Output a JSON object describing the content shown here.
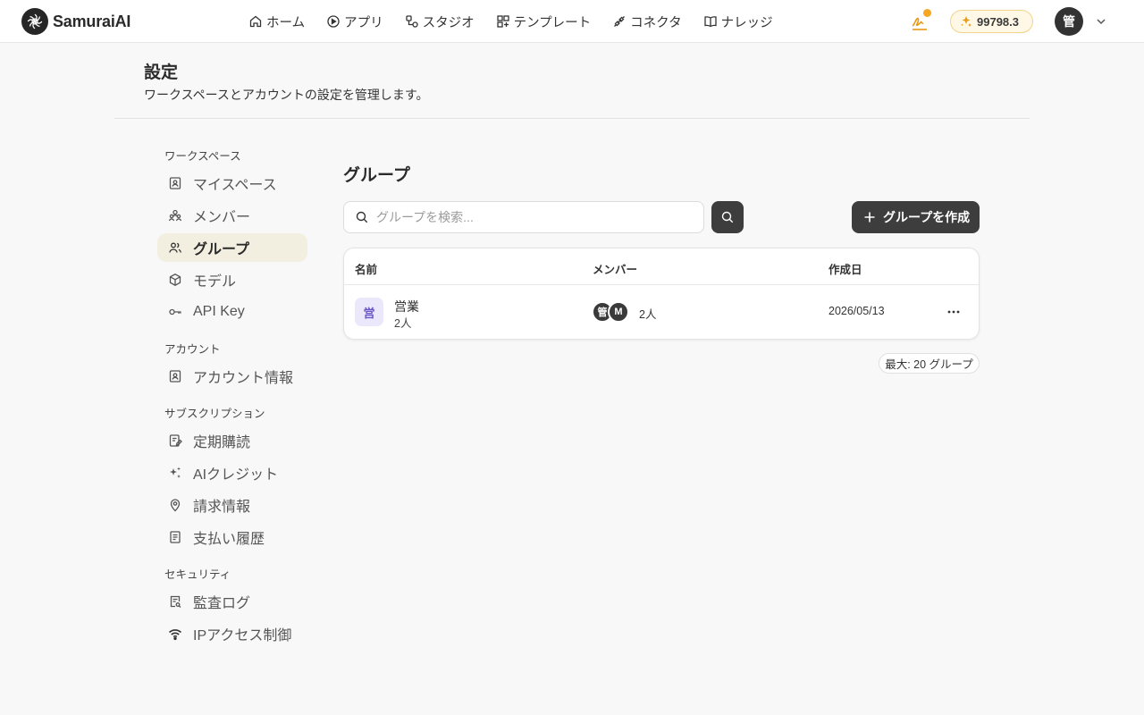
{
  "brand": {
    "name": "SamuraiAI"
  },
  "nav": {
    "items": [
      {
        "label": "ホーム",
        "icon": "home-icon"
      },
      {
        "label": "アプリ",
        "icon": "app-icon"
      },
      {
        "label": "スタジオ",
        "icon": "studio-icon"
      },
      {
        "label": "テンプレート",
        "icon": "template-icon"
      },
      {
        "label": "コネクタ",
        "icon": "connector-icon"
      },
      {
        "label": "ナレッジ",
        "icon": "book-icon"
      }
    ]
  },
  "header_right": {
    "credits": "99798.3",
    "avatar_initial": "管"
  },
  "page": {
    "title": "設定",
    "subtitle": "ワークスペースとアカウントの設定を管理します。"
  },
  "sidebar": {
    "sections": [
      {
        "label": "ワークスペース"
      },
      {
        "label": "アカウント"
      },
      {
        "label": "サブスクリプション"
      },
      {
        "label": "セキュリティ"
      }
    ],
    "items": [
      {
        "label": "マイスペース",
        "icon": "user-card-icon"
      },
      {
        "label": "メンバー",
        "icon": "members-icon"
      },
      {
        "label": "グループ",
        "icon": "group-icon",
        "active": true
      },
      {
        "label": "モデル",
        "icon": "cube-icon"
      },
      {
        "label": "API Key",
        "icon": "key-icon"
      },
      {
        "label": "アカウント情報",
        "icon": "user-card-icon"
      },
      {
        "label": "定期購読",
        "icon": "subscription-icon"
      },
      {
        "label": "AIクレジット",
        "icon": "sparkle-icon"
      },
      {
        "label": "請求情報",
        "icon": "location-pin-icon"
      },
      {
        "label": "支払い履歴",
        "icon": "receipt-icon"
      },
      {
        "label": "監査ログ",
        "icon": "audit-log-icon"
      },
      {
        "label": "IPアクセス制御",
        "icon": "wifi-icon"
      }
    ]
  },
  "main": {
    "title": "グループ",
    "search_placeholder": "グループを検索...",
    "create_label": "グループを作成",
    "table": {
      "headers": [
        "名前",
        "メンバー",
        "作成日"
      ],
      "rows": [
        {
          "badge": "営",
          "name": "営業",
          "count": "2人",
          "member_avatars": [
            "管",
            "M"
          ],
          "member_count": "2人",
          "created": "2026/05/13"
        }
      ]
    },
    "limit": "最大: 20 グループ"
  },
  "colors": {
    "accent_dark": "#3d3d3d",
    "active_bg": "#f3efe0",
    "credit_bg": "#fff8e6",
    "notification": "#f5a623",
    "group_badge_bg": "#ece8fb",
    "group_badge_fg": "#6a55c8"
  }
}
